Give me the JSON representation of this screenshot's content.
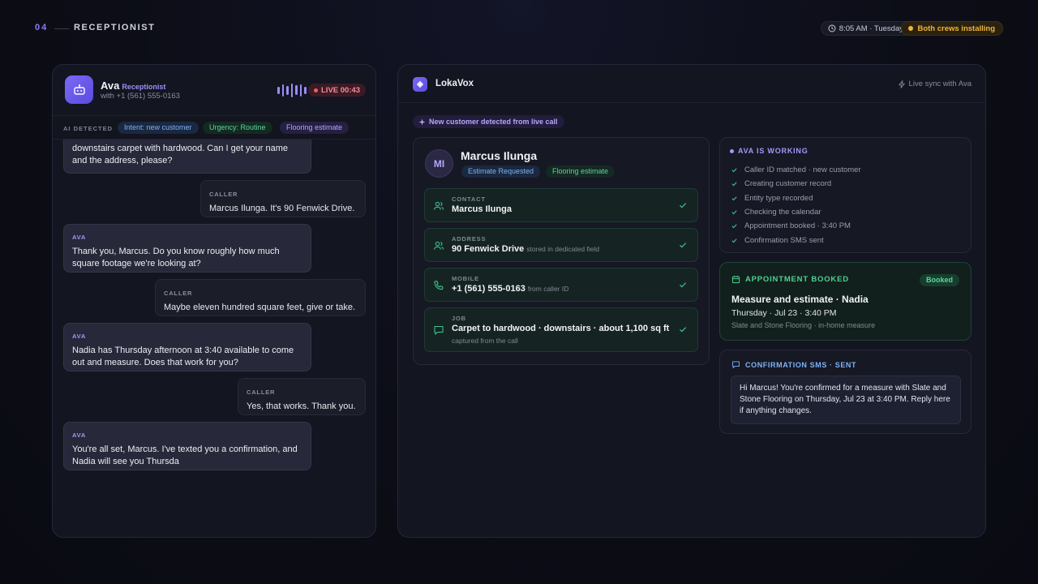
{
  "header": {
    "section_number": "04",
    "section_title": "RECEPTIONIST",
    "time": "8:05 AM · Tuesday",
    "status": "Both crews installing",
    "colors": {
      "accent": "#8b7cf6",
      "warning": "#f0b43c"
    }
  },
  "call": {
    "agent_name": "Ava",
    "agent_role": "Receptionist",
    "with_number": "with +1 (561) 555-0163",
    "live_label": "LIVE 00:43",
    "detected_label": "AI DETECTED",
    "chips": [
      {
        "label": "Intent: new customer"
      },
      {
        "label": "Urgency: Routine"
      },
      {
        "label": "Flooring estimate"
      }
    ],
    "messages": [
      {
        "speaker": "",
        "text": "downstairs carpet with hardwood. Can I get your name and the address, please?"
      },
      {
        "speaker": "CALLER",
        "text": "Marcus Ilunga. It's 90 Fenwick Drive."
      },
      {
        "speaker": "AVA",
        "text": "Thank you, Marcus. Do you know roughly how much square footage we're looking at?"
      },
      {
        "speaker": "CALLER",
        "text": "Maybe eleven hundred square feet, give or take."
      },
      {
        "speaker": "AVA",
        "text": "Nadia has Thursday afternoon at 3:40 available to come out and measure. Does that work for you?"
      },
      {
        "speaker": "CALLER",
        "text": "Yes, that works. Thank you."
      },
      {
        "speaker": "AVA",
        "text": "You're all set, Marcus. I've texted you a confirmation, and Nadia will see you Thursda"
      }
    ]
  },
  "crm": {
    "app_name": "LokaVox",
    "sync_label": "Live sync with Ava",
    "new_customer_banner": "New customer detected from live call",
    "customer": {
      "initials": "MI",
      "name": "Marcus Ilunga",
      "tags": [
        "Estimate Requested",
        "Flooring estimate"
      ],
      "fields": [
        {
          "label": "CONTACT",
          "value": "Marcus Ilunga",
          "note": "",
          "sub": "",
          "icon": "users-icon"
        },
        {
          "label": "ADDRESS",
          "value": "90 Fenwick Drive",
          "note": "stored in dedicated field",
          "sub": "",
          "icon": "users-icon"
        },
        {
          "label": "MOBILE",
          "value": "+1 (561) 555-0163",
          "note": "from caller ID",
          "sub": "",
          "icon": "phone-icon"
        },
        {
          "label": "JOB",
          "value": "Carpet to hardwood · downstairs · about 1,100 sq ft",
          "note": "",
          "sub": "captured from the call",
          "icon": "message-icon"
        }
      ]
    },
    "working": {
      "title": "AVA IS WORKING",
      "steps": [
        "Caller ID matched · new customer",
        "Creating customer record",
        "Entity type recorded",
        "Checking the calendar",
        "Appointment booked · 3:40 PM",
        "Confirmation SMS sent"
      ]
    },
    "appointment": {
      "title": "APPOINTMENT BOOKED",
      "badge": "Booked",
      "headline": "Measure and estimate · Nadia",
      "when": "Thursday · Jul 23 · 3:40 PM",
      "where": "Slate and Stone Flooring · in-home measure"
    },
    "sms": {
      "title": "CONFIRMATION SMS · SENT",
      "body": "Hi Marcus! You're confirmed for a measure with Slate and Stone Flooring on Thursday, Jul 23 at 3:40 PM. Reply here if anything changes."
    }
  }
}
